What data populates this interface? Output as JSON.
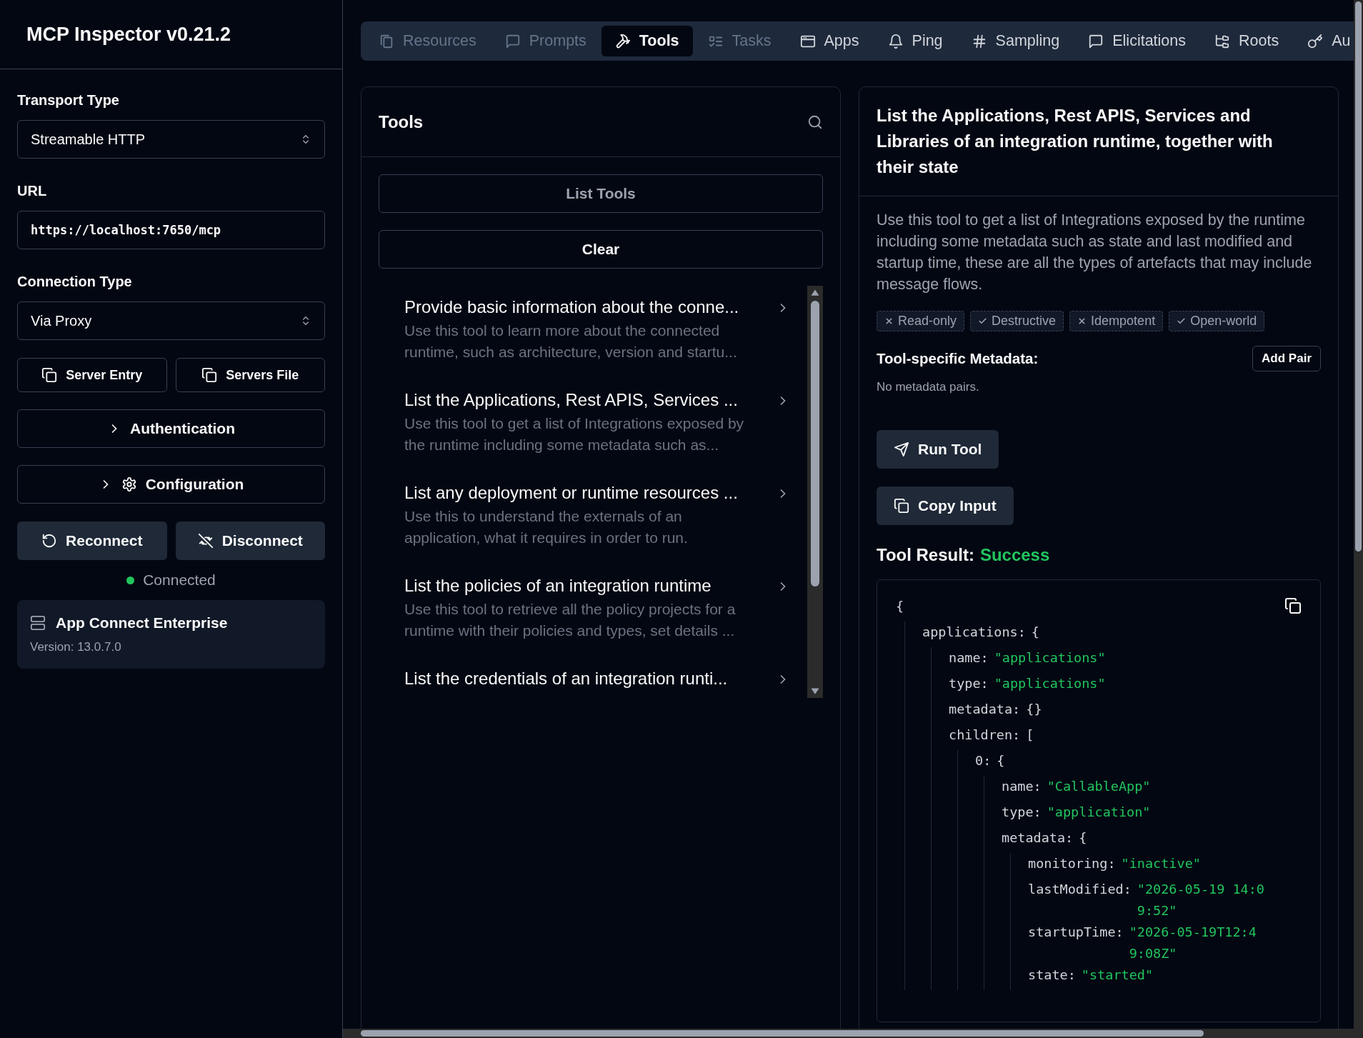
{
  "sidebar": {
    "title": "MCP Inspector v0.21.2",
    "transport_label": "Transport Type",
    "transport_value": "Streamable HTTP",
    "url_label": "URL",
    "url_value": "https://localhost:7650/mcp",
    "connection_label": "Connection Type",
    "connection_value": "Via Proxy",
    "copy_buttons": [
      "Server Entry",
      "Servers File"
    ],
    "sections": [
      {
        "label": "Authentication",
        "kind": "plain",
        "expanded": false
      },
      {
        "label": "Configuration",
        "kind": "gear",
        "expanded": false
      }
    ],
    "actions": [
      {
        "label": "Reconnect",
        "kind": "reconnect"
      },
      {
        "label": "Disconnect",
        "kind": "disconnect"
      }
    ],
    "status": {
      "label": "Connected",
      "color": "#22c55e"
    },
    "server": {
      "name": "App Connect Enterprise",
      "version": "Version: 13.0.7.0"
    }
  },
  "tabs": [
    {
      "label": "Resources",
      "kind": "files",
      "selected": false,
      "disabled": true
    },
    {
      "label": "Prompts",
      "kind": "chat",
      "selected": false,
      "disabled": true
    },
    {
      "label": "Tools",
      "kind": "hammer",
      "selected": true,
      "disabled": false
    },
    {
      "label": "Tasks",
      "kind": "list",
      "selected": false,
      "disabled": true
    },
    {
      "label": "Apps",
      "kind": "window",
      "selected": false,
      "disabled": false
    },
    {
      "label": "Ping",
      "kind": "bell",
      "selected": false,
      "disabled": false
    },
    {
      "label": "Sampling",
      "kind": "hash",
      "selected": false,
      "disabled": false
    },
    {
      "label": "Elicitations",
      "kind": "chat",
      "selected": false,
      "disabled": false
    },
    {
      "label": "Roots",
      "kind": "tree",
      "selected": false,
      "disabled": false
    },
    {
      "label": "Au",
      "kind": "key",
      "selected": false,
      "disabled": false
    }
  ],
  "tools_panel": {
    "title": "Tools",
    "list_button": {
      "label": "List Tools",
      "disabled": true
    },
    "clear_button": {
      "label": "Clear",
      "disabled": false
    },
    "items": [
      {
        "title": "Provide basic information about the conne...",
        "description": "Use this tool to learn more about the connected runtime, such as architecture, version and startu..."
      },
      {
        "title": "List the Applications, Rest APIS, Services ...",
        "description": "Use this tool to get a list of Integrations exposed by the runtime including some metadata such as..."
      },
      {
        "title": "List any deployment or runtime resources ...",
        "description": "Use this to understand the externals of an application, what it requires in order to run."
      },
      {
        "title": "List the policies of an integration runtime",
        "description": "Use this tool to retrieve all the policy projects for a runtime with their policies and types, set details ..."
      },
      {
        "title": "List the credentials of an integration runti..."
      }
    ]
  },
  "detail": {
    "title": "List the Applications, Rest APIS, Services and Libraries of an integration runtime, together with their state",
    "description": "Use this tool to get a list of Integrations exposed by the runtime including some metadata such as state and last modified and startup time, these are all the types of artefacts that may include message flows.",
    "hints": [
      {
        "label": "Read-only",
        "on": false
      },
      {
        "label": "Destructive",
        "on": true
      },
      {
        "label": "Idempotent",
        "on": false
      },
      {
        "label": "Open-world",
        "on": true
      }
    ],
    "metadata_label": "Tool-specific Metadata:",
    "add_pair": "Add Pair",
    "metadata_empty": "No metadata pairs.",
    "run_button": "Run Tool",
    "copy_button": "Copy Input",
    "result_label": "Tool Result:",
    "result_status": "Success",
    "result": {
      "open": "{",
      "children": [
        {
          "key": "applications:",
          "open": "{",
          "children": [
            {
              "key": "name:",
              "value": "\"applications\""
            },
            {
              "key": "type:",
              "value": "\"applications\""
            },
            {
              "key": "metadata:",
              "open": "{}"
            },
            {
              "key": "children:",
              "open": "[",
              "children": [
                {
                  "key": "0:",
                  "open": "{",
                  "children": [
                    {
                      "key": "name:",
                      "value": "\"CallableApp\""
                    },
                    {
                      "key": "type:",
                      "value": "\"application\""
                    },
                    {
                      "key": "metadata:",
                      "open": "{",
                      "children": [
                        {
                          "key": "monitoring:",
                          "value": "\"inactive\""
                        },
                        {
                          "key": "lastModified:",
                          "value": "\"2026-05-19 14:09:52\""
                        },
                        {
                          "key": "startupTime:",
                          "value": "\"2026-05-19T12:49:08Z\""
                        },
                        {
                          "key": "state:",
                          "value": "\"started\""
                        }
                      ]
                    }
                  ]
                }
              ]
            }
          ]
        }
      ]
    }
  }
}
